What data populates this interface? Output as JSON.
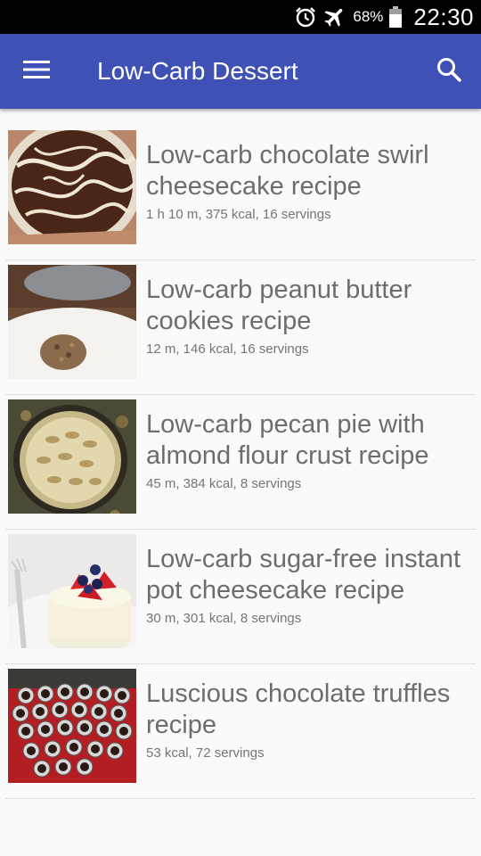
{
  "status_bar": {
    "battery": "68%",
    "time": "22:30",
    "icons": [
      "alarm-icon",
      "airplane-icon",
      "battery-icon"
    ]
  },
  "app_bar": {
    "title": "Low-Carb Dessert",
    "color": "#3f51b5",
    "icons": [
      "menu-icon",
      "search-icon"
    ]
  },
  "recipes": [
    {
      "title": "Low-carb chocolate swirl cheesecake recipe",
      "meta": "1 h 10 m, 375 kcal, 16 servings"
    },
    {
      "title": "Low-carb peanut butter cookies recipe",
      "meta": "12 m, 146 kcal, 16 servings"
    },
    {
      "title": "Low-carb pecan pie with almond flour crust recipe",
      "meta": "45 m, 384 kcal, 8 servings"
    },
    {
      "title": "Low-carb sugar-free instant pot cheesecake recipe",
      "meta": "30 m, 301 kcal, 8 servings"
    },
    {
      "title": "Luscious chocolate truffles recipe",
      "meta": "53 kcal, 72 servings"
    }
  ]
}
